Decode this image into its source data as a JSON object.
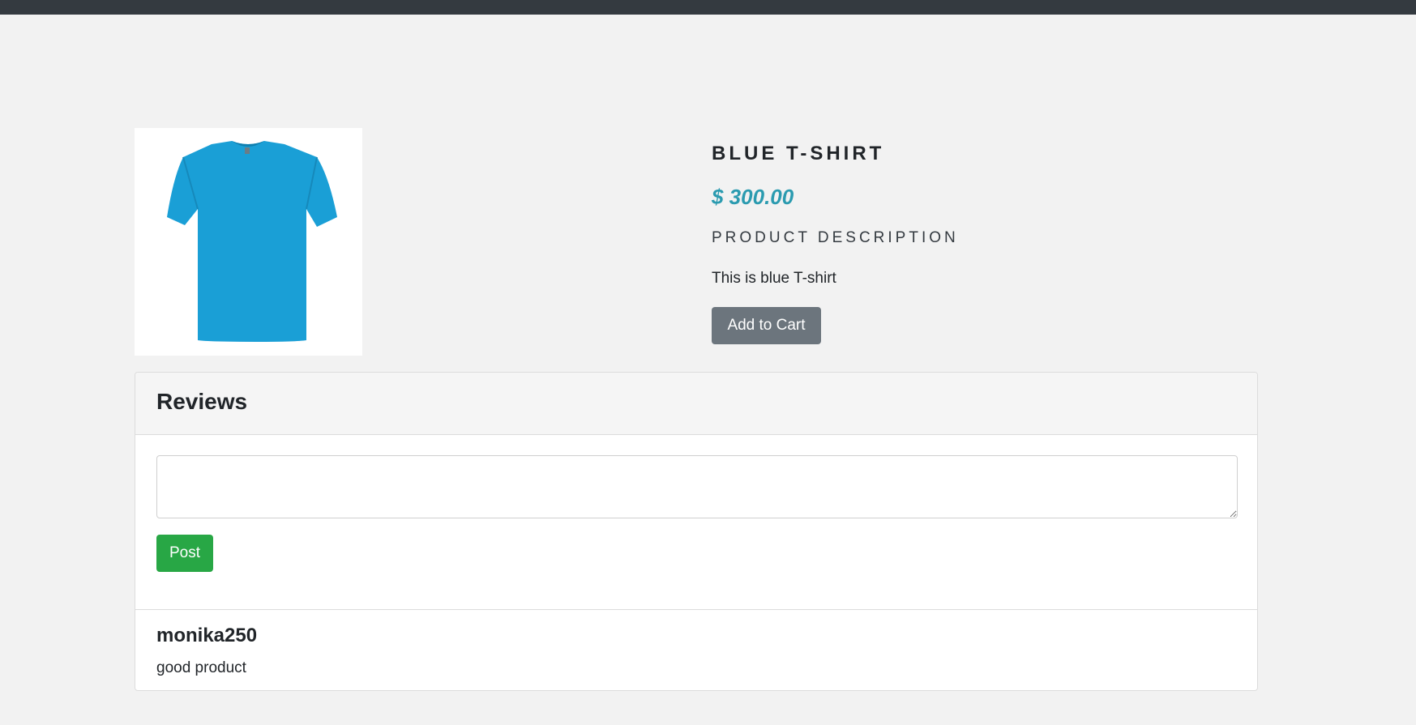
{
  "product": {
    "image_icon": "blue-tshirt-image",
    "title": "BLUE T-SHIRT",
    "price": "$ 300.00",
    "description_heading": "PRODUCT DESCRIPTION",
    "description": "This is blue T-shirt",
    "add_to_cart_label": "Add to Cart"
  },
  "reviews": {
    "title": "Reviews",
    "input_value": "",
    "post_label": "Post",
    "items": [
      {
        "author": "monika250",
        "text": "good product"
      }
    ]
  },
  "colors": {
    "navbar": "#343a40",
    "background": "#f2f2f2",
    "price": "#2b9bb0",
    "add_to_cart_button": "#6c757d",
    "post_button": "#28a745",
    "tshirt": "#1a9fd6"
  }
}
